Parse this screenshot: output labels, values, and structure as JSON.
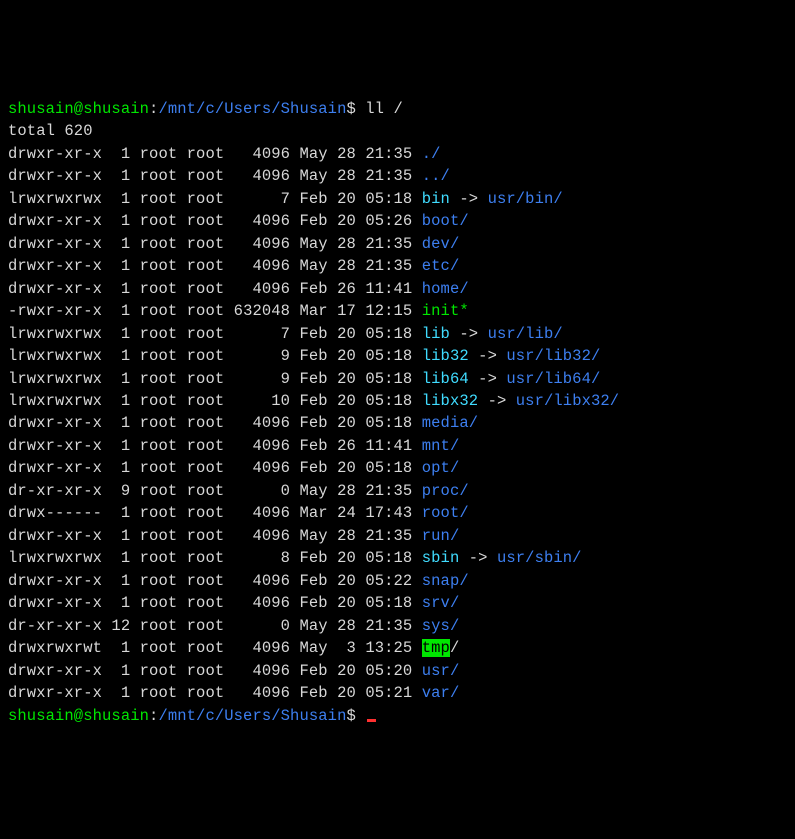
{
  "prompt1": {
    "user_host": "shusain@shusain",
    "sep1": ":",
    "cwd": "/mnt/c/Users/Shusain",
    "dollar": "$ ",
    "cmd": "ll /"
  },
  "total_line": "total 620",
  "rows": [
    {
      "perms": "drwxr-xr-x",
      "nl": "1",
      "own": "root",
      "grp": "root",
      "size": "4096",
      "mon": "May",
      "day": "28",
      "time": "21:35",
      "name": "./",
      "cls": "blue",
      "link": ""
    },
    {
      "perms": "drwxr-xr-x",
      "nl": "1",
      "own": "root",
      "grp": "root",
      "size": "4096",
      "mon": "May",
      "day": "28",
      "time": "21:35",
      "name": "../",
      "cls": "blue",
      "link": ""
    },
    {
      "perms": "lrwxrwxrwx",
      "nl": "1",
      "own": "root",
      "grp": "root",
      "size": "7",
      "mon": "Feb",
      "day": "20",
      "time": "05:18",
      "name": "bin",
      "cls": "cyan",
      "link": "usr/bin/"
    },
    {
      "perms": "drwxr-xr-x",
      "nl": "1",
      "own": "root",
      "grp": "root",
      "size": "4096",
      "mon": "Feb",
      "day": "20",
      "time": "05:26",
      "name": "boot/",
      "cls": "blue",
      "link": ""
    },
    {
      "perms": "drwxr-xr-x",
      "nl": "1",
      "own": "root",
      "grp": "root",
      "size": "4096",
      "mon": "May",
      "day": "28",
      "time": "21:35",
      "name": "dev/",
      "cls": "blue",
      "link": ""
    },
    {
      "perms": "drwxr-xr-x",
      "nl": "1",
      "own": "root",
      "grp": "root",
      "size": "4096",
      "mon": "May",
      "day": "28",
      "time": "21:35",
      "name": "etc/",
      "cls": "blue",
      "link": ""
    },
    {
      "perms": "drwxr-xr-x",
      "nl": "1",
      "own": "root",
      "grp": "root",
      "size": "4096",
      "mon": "Feb",
      "day": "26",
      "time": "11:41",
      "name": "home/",
      "cls": "blue",
      "link": ""
    },
    {
      "perms": "-rwxr-xr-x",
      "nl": "1",
      "own": "root",
      "grp": "root",
      "size": "632048",
      "mon": "Mar",
      "day": "17",
      "time": "12:15",
      "name": "init*",
      "cls": "green",
      "link": ""
    },
    {
      "perms": "lrwxrwxrwx",
      "nl": "1",
      "own": "root",
      "grp": "root",
      "size": "7",
      "mon": "Feb",
      "day": "20",
      "time": "05:18",
      "name": "lib",
      "cls": "cyan",
      "link": "usr/lib/"
    },
    {
      "perms": "lrwxrwxrwx",
      "nl": "1",
      "own": "root",
      "grp": "root",
      "size": "9",
      "mon": "Feb",
      "day": "20",
      "time": "05:18",
      "name": "lib32",
      "cls": "cyan",
      "link": "usr/lib32/"
    },
    {
      "perms": "lrwxrwxrwx",
      "nl": "1",
      "own": "root",
      "grp": "root",
      "size": "9",
      "mon": "Feb",
      "day": "20",
      "time": "05:18",
      "name": "lib64",
      "cls": "cyan",
      "link": "usr/lib64/"
    },
    {
      "perms": "lrwxrwxrwx",
      "nl": "1",
      "own": "root",
      "grp": "root",
      "size": "10",
      "mon": "Feb",
      "day": "20",
      "time": "05:18",
      "name": "libx32",
      "cls": "cyan",
      "link": "usr/libx32/"
    },
    {
      "perms": "drwxr-xr-x",
      "nl": "1",
      "own": "root",
      "grp": "root",
      "size": "4096",
      "mon": "Feb",
      "day": "20",
      "time": "05:18",
      "name": "media/",
      "cls": "blue",
      "link": ""
    },
    {
      "perms": "drwxr-xr-x",
      "nl": "1",
      "own": "root",
      "grp": "root",
      "size": "4096",
      "mon": "Feb",
      "day": "26",
      "time": "11:41",
      "name": "mnt/",
      "cls": "blue",
      "link": ""
    },
    {
      "perms": "drwxr-xr-x",
      "nl": "1",
      "own": "root",
      "grp": "root",
      "size": "4096",
      "mon": "Feb",
      "day": "20",
      "time": "05:18",
      "name": "opt/",
      "cls": "blue",
      "link": ""
    },
    {
      "perms": "dr-xr-xr-x",
      "nl": "9",
      "own": "root",
      "grp": "root",
      "size": "0",
      "mon": "May",
      "day": "28",
      "time": "21:35",
      "name": "proc/",
      "cls": "blue",
      "link": ""
    },
    {
      "perms": "drwx------",
      "nl": "1",
      "own": "root",
      "grp": "root",
      "size": "4096",
      "mon": "Mar",
      "day": "24",
      "time": "17:43",
      "name": "root/",
      "cls": "blue",
      "link": ""
    },
    {
      "perms": "drwxr-xr-x",
      "nl": "1",
      "own": "root",
      "grp": "root",
      "size": "4096",
      "mon": "May",
      "day": "28",
      "time": "21:35",
      "name": "run/",
      "cls": "blue",
      "link": ""
    },
    {
      "perms": "lrwxrwxrwx",
      "nl": "1",
      "own": "root",
      "grp": "root",
      "size": "8",
      "mon": "Feb",
      "day": "20",
      "time": "05:18",
      "name": "sbin",
      "cls": "cyan",
      "link": "usr/sbin/"
    },
    {
      "perms": "drwxr-xr-x",
      "nl": "1",
      "own": "root",
      "grp": "root",
      "size": "4096",
      "mon": "Feb",
      "day": "20",
      "time": "05:22",
      "name": "snap/",
      "cls": "blue",
      "link": ""
    },
    {
      "perms": "drwxr-xr-x",
      "nl": "1",
      "own": "root",
      "grp": "root",
      "size": "4096",
      "mon": "Feb",
      "day": "20",
      "time": "05:18",
      "name": "srv/",
      "cls": "blue",
      "link": ""
    },
    {
      "perms": "dr-xr-xr-x",
      "nl": "12",
      "own": "root",
      "grp": "root",
      "size": "0",
      "mon": "May",
      "day": "28",
      "time": "21:35",
      "name": "sys/",
      "cls": "blue",
      "link": ""
    },
    {
      "perms": "drwxrwxrwt",
      "nl": "1",
      "own": "root",
      "grp": "root",
      "size": "4096",
      "mon": "May",
      "day": " 3",
      "time": "13:25",
      "name": "tmp",
      "cls": "tmp",
      "link": "",
      "suffix": "/"
    },
    {
      "perms": "drwxr-xr-x",
      "nl": "1",
      "own": "root",
      "grp": "root",
      "size": "4096",
      "mon": "Feb",
      "day": "20",
      "time": "05:20",
      "name": "usr/",
      "cls": "blue",
      "link": ""
    },
    {
      "perms": "drwxr-xr-x",
      "nl": "1",
      "own": "root",
      "grp": "root",
      "size": "4096",
      "mon": "Feb",
      "day": "20",
      "time": "05:21",
      "name": "var/",
      "cls": "blue",
      "link": ""
    }
  ],
  "prompt2": {
    "user_host": "shusain@shusain",
    "sep1": ":",
    "cwd": "/mnt/c/Users/Shusain",
    "dollar": "$ "
  },
  "arrow": " -> "
}
